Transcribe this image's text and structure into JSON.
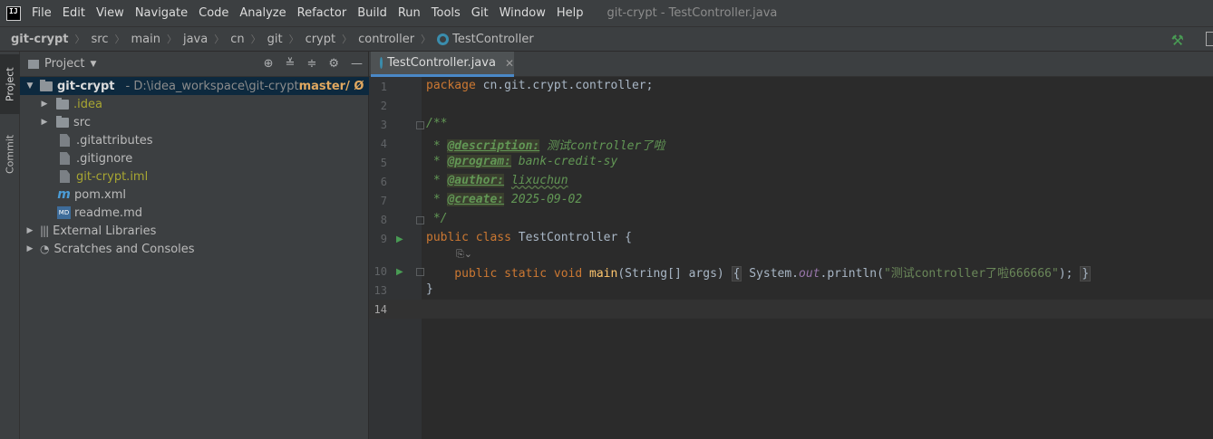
{
  "menubar": {
    "items": [
      {
        "label": "File"
      },
      {
        "label": "Edit"
      },
      {
        "label": "View"
      },
      {
        "label": "Navigate"
      },
      {
        "label": "Code"
      },
      {
        "label": "Analyze"
      },
      {
        "label": "Refactor"
      },
      {
        "label": "Build"
      },
      {
        "label": "Run"
      },
      {
        "label": "Tools"
      },
      {
        "label": "Git"
      },
      {
        "label": "Window"
      },
      {
        "label": "Help"
      }
    ],
    "window_title": "git-crypt - TestController.java"
  },
  "breadcrumb": [
    "git-crypt",
    "src",
    "main",
    "java",
    "cn",
    "git",
    "crypt",
    "controller",
    "TestController"
  ],
  "tool_stripe": {
    "project_label": "Project",
    "commit_label": "Commit"
  },
  "project_panel": {
    "title": "Project",
    "tree": [
      {
        "name": "git-crypt",
        "path": "D:\\idea_workspace\\git-crypt",
        "branch": "master/ Ø"
      },
      {
        "name": ".idea"
      },
      {
        "name": "src"
      },
      {
        "name": ".gitattributes"
      },
      {
        "name": ".gitignore"
      },
      {
        "name": "git-crypt.iml"
      },
      {
        "name": "pom.xml"
      },
      {
        "name": "readme.md"
      },
      {
        "name": "External Libraries"
      },
      {
        "name": "Scratches and Consoles"
      }
    ]
  },
  "editor": {
    "tab_label": "TestController.java",
    "active_line": "14",
    "line_numbers": [
      "1",
      "2",
      "3",
      "4",
      "5",
      "6",
      "7",
      "8",
      "9",
      "10",
      "13",
      "14"
    ],
    "code": {
      "l1_kw": "package",
      "l1_rest": " cn.git.crypt.controller;",
      "l3": "/**",
      "l4_pre": " * ",
      "l4_tag": "@description:",
      "l4_val": " 测试controller了啦",
      "l5_pre": " * ",
      "l5_tag": "@program:",
      "l5_val": " bank-credit-sy",
      "l6_pre": " * ",
      "l6_tag": "@author:",
      "l6_sp": " ",
      "l6_val": "lixuchun",
      "l7_pre": " * ",
      "l7_tag": "@create:",
      "l7_val": " 2025-09-02",
      "l8": " */",
      "l9_kw": "public class",
      "l9_name": " TestController {",
      "l10_kw": "    public static void",
      "l10_fn": " main",
      "l10_args": "(String[] args) ",
      "l10_ob": "{",
      "l10_sys": " System.",
      "l10_out": "out",
      "l10_call": ".println(",
      "l10_str": "\"测试controller了啦666666\"",
      "l10_end": ");",
      "l10_cb": "}",
      "l13": "}"
    }
  }
}
